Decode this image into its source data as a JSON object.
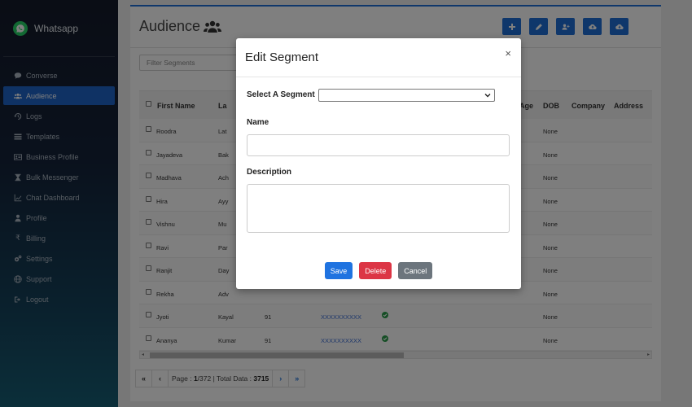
{
  "app": {
    "name": "Whatsapp"
  },
  "sidebar": {
    "items": [
      {
        "label": "Converse",
        "icon": "chat-icon",
        "active": false
      },
      {
        "label": "Audience",
        "icon": "users-icon",
        "active": true
      },
      {
        "label": "Logs",
        "icon": "history-icon",
        "active": false
      },
      {
        "label": "Templates",
        "icon": "list-icon",
        "active": false
      },
      {
        "label": "Business Profile",
        "icon": "id-card-icon",
        "active": false
      },
      {
        "label": "Bulk Messenger",
        "icon": "hourglass-icon",
        "active": false
      },
      {
        "label": "Chat Dashboard",
        "icon": "line-chart-icon",
        "active": false
      },
      {
        "label": "Profile",
        "icon": "user-icon",
        "active": false
      },
      {
        "label": "Billing",
        "icon": "rupee-icon",
        "active": false
      },
      {
        "label": "Settings",
        "icon": "gears-icon",
        "active": false
      },
      {
        "label": "Support",
        "icon": "globe-icon",
        "active": false
      },
      {
        "label": "Logout",
        "icon": "sign-out-icon",
        "active": false
      }
    ]
  },
  "page": {
    "title": "Audience",
    "filter_placeholder": "Filter Segments",
    "toolbar": [
      "plus-icon",
      "edit-icon",
      "user-plus-icon",
      "cloud-upload-icon",
      "cloud-download-icon"
    ]
  },
  "table": {
    "headers": {
      "first_name": "First Name",
      "last_name": "La",
      "age": "Age",
      "dob": "DOB",
      "company": "Company",
      "address": "Address"
    },
    "rows": [
      {
        "first": "Roodra",
        "last": "Lat",
        "code": "",
        "phone": "",
        "check": false,
        "dob": "None"
      },
      {
        "first": "Jayadeva",
        "last": "Bak",
        "code": "",
        "phone": "",
        "check": false,
        "dob": "None"
      },
      {
        "first": "Madhava",
        "last": "Ach",
        "code": "",
        "phone": "",
        "check": false,
        "dob": "None"
      },
      {
        "first": "Hira",
        "last": "Ayy",
        "code": "",
        "phone": "",
        "check": false,
        "dob": "None"
      },
      {
        "first": "Vishnu",
        "last": "Mu",
        "code": "",
        "phone": "",
        "check": false,
        "dob": "None"
      },
      {
        "first": "Ravi",
        "last": "Par",
        "code": "",
        "phone": "",
        "check": false,
        "dob": "None"
      },
      {
        "first": "Ranjit",
        "last": "Day",
        "code": "",
        "phone": "",
        "check": false,
        "dob": "None"
      },
      {
        "first": "Rekha",
        "last": "Adv",
        "code": "",
        "phone": "",
        "check": false,
        "dob": "None"
      },
      {
        "first": "Jyoti",
        "last": "Kayal",
        "code": "91",
        "phone": "XXXXXXXXXX",
        "check": true,
        "dob": "None"
      },
      {
        "first": "Ananya",
        "last": "Kumar",
        "code": "91",
        "phone": "XXXXXXXXXX",
        "check": true,
        "dob": "None"
      }
    ]
  },
  "pagination": {
    "page_label": "Page : ",
    "page_current": "1",
    "page_total": "/372",
    "sep": " | ",
    "total_label": "Total Data : ",
    "total": "3715"
  },
  "modal": {
    "title": "Edit Segment",
    "close": "×",
    "select_label": "Select A Segment",
    "select_value": "",
    "name_label": "Name",
    "name_value": "",
    "description_label": "Description",
    "description_value": "",
    "save": "Save",
    "delete": "Delete",
    "cancel": "Cancel"
  },
  "colors": {
    "accent": "#1e6fd6",
    "danger": "#dc3545",
    "secondary": "#6c757d",
    "whatsapp": "#25d366"
  }
}
